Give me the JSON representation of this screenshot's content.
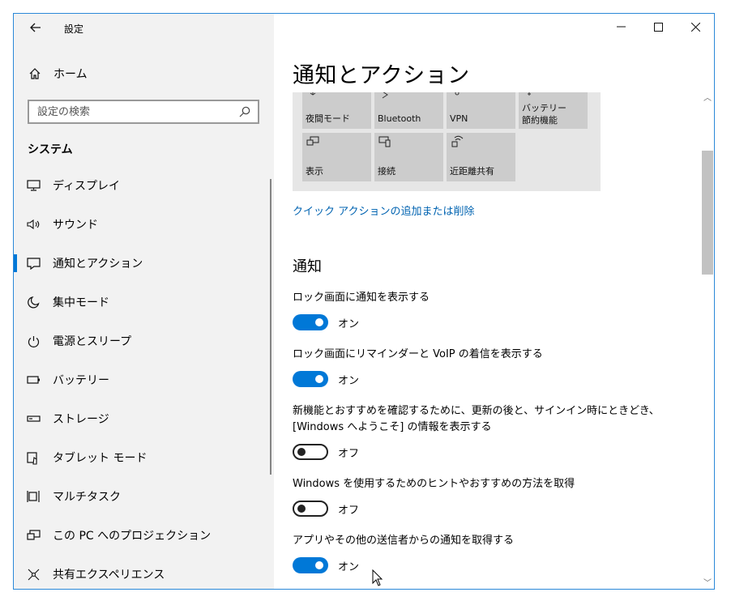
{
  "window": {
    "title": "設定",
    "back_icon": "back-arrow-icon"
  },
  "sidebar": {
    "home_label": "ホーム",
    "search_placeholder": "設定の検索",
    "section_title": "システム",
    "items": [
      {
        "label": "ディスプレイ",
        "icon": "display-icon"
      },
      {
        "label": "サウンド",
        "icon": "speaker-icon"
      },
      {
        "label": "通知とアクション",
        "icon": "notification-icon",
        "active": true
      },
      {
        "label": "集中モード",
        "icon": "moon-icon"
      },
      {
        "label": "電源とスリープ",
        "icon": "power-icon"
      },
      {
        "label": "バッテリー",
        "icon": "battery-icon"
      },
      {
        "label": "ストレージ",
        "icon": "storage-icon"
      },
      {
        "label": "タブレット モード",
        "icon": "tablet-icon"
      },
      {
        "label": "マルチタスク",
        "icon": "multitask-icon"
      },
      {
        "label": "この PC へのプロジェクション",
        "icon": "projection-icon"
      },
      {
        "label": "共有エクスペリエンス",
        "icon": "share-icon"
      }
    ]
  },
  "main": {
    "title": "通知とアクション",
    "quick_actions": [
      {
        "label": "夜間モード",
        "icon": "brightness-icon"
      },
      {
        "label": "Bluetooth",
        "icon": "bluetooth-icon"
      },
      {
        "label": "VPN",
        "icon": "vpn-icon"
      },
      {
        "label": "バッテリー\n節約機能",
        "icon": "battery-saver-icon"
      },
      {
        "label": "表示",
        "icon": "project-icon"
      },
      {
        "label": "接続",
        "icon": "connect-icon"
      },
      {
        "label": "近距離共有",
        "icon": "nearby-share-icon"
      }
    ],
    "qa_link": "クイック アクションの追加または削除",
    "notifications_heading": "通知",
    "settings": [
      {
        "label": "ロック画面に通知を表示する",
        "state": "オン",
        "on": true
      },
      {
        "label": "ロック画面にリマインダーと VoIP の着信を表示する",
        "state": "オン",
        "on": true
      },
      {
        "label_line1": "新機能とおすすめを確認するために、更新の後と、サインイン時にときどき、",
        "label_line2": "[Windows へようこそ] の情報を表示する",
        "state": "オフ",
        "on": false
      },
      {
        "label": "Windows を使用するためのヒントやおすすめの方法を取得",
        "state": "オフ",
        "on": false
      },
      {
        "label": "アプリやその他の送信者からの通知を取得する",
        "state": "オン",
        "on": true
      }
    ]
  }
}
